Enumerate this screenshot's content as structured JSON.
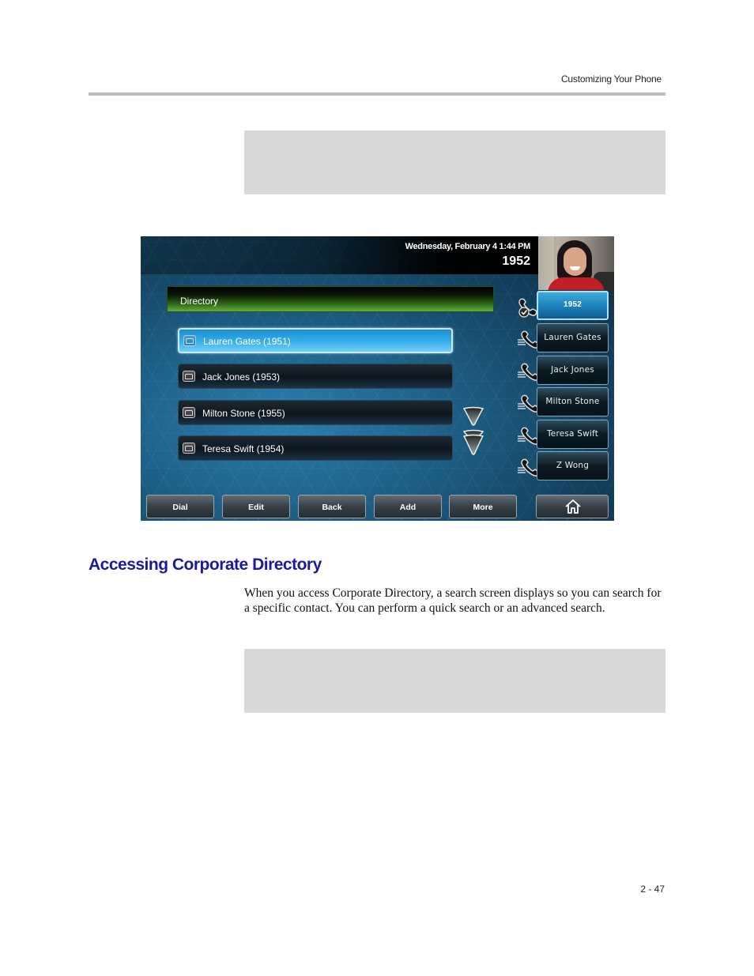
{
  "page": {
    "running_header": "Customizing Your Phone",
    "page_number": "2 - 47"
  },
  "phone_screen": {
    "datetime": "Wednesday, February 4  1:44 PM",
    "extension": "1952",
    "title": "Directory",
    "entries": [
      {
        "label": "Lauren Gates (1951)",
        "selected": true,
        "icon": "book-icon"
      },
      {
        "label": "Jack Jones (1953)",
        "selected": false,
        "icon": "book-icon"
      },
      {
        "label": "Milton Stone (1955)",
        "selected": false,
        "icon": "book-icon"
      },
      {
        "label": "Teresa Swift (1954)",
        "selected": false,
        "icon": "book-icon"
      }
    ],
    "scroll": {
      "down_icon": "chevron-down-icon",
      "page_down_icon": "double-chevron-down-icon"
    },
    "line_keys": [
      {
        "label": "1952",
        "active": true,
        "icon": "handset-check-icon"
      },
      {
        "label": "Lauren Gates",
        "active": false,
        "icon": "speed-dial-icon"
      },
      {
        "label": "Jack Jones",
        "active": false,
        "icon": "speed-dial-icon"
      },
      {
        "label": "Milton Stone",
        "active": false,
        "icon": "speed-dial-icon"
      },
      {
        "label": "Teresa Swift",
        "active": false,
        "icon": "speed-dial-icon"
      },
      {
        "label": "Z Wong",
        "active": false,
        "icon": "speed-dial-icon"
      }
    ],
    "softkeys": [
      "Dial",
      "Edit",
      "Back",
      "Add",
      "More"
    ],
    "home_icon": "home-icon",
    "colors": {
      "selected_entry": "#2fa8e6",
      "title_bar_green": "#63ad3a",
      "background_blue": "#1d5f86"
    }
  },
  "section": {
    "heading": "Accessing Corporate Directory",
    "body": "When you access Corporate Directory, a search screen displays so you can search for a specific contact. You can perform a quick search or an advanced search."
  },
  "colors": {
    "heading": "#1a1aa0",
    "note_box": "#d9d9d9",
    "rule": "#bdbdbd"
  }
}
